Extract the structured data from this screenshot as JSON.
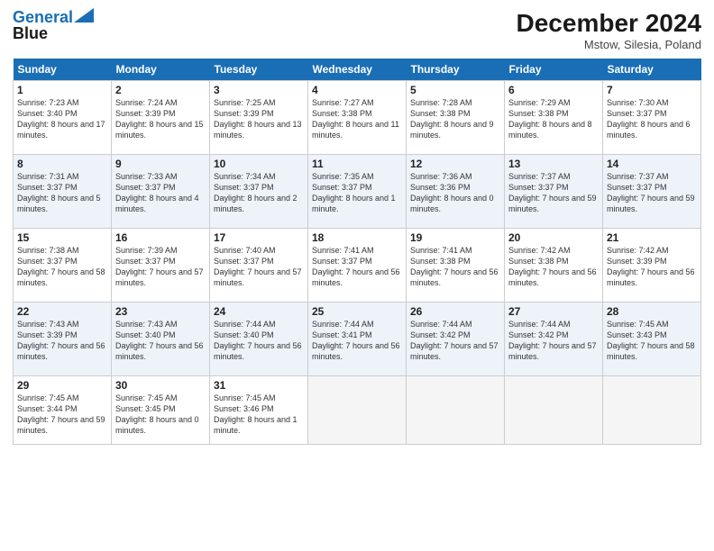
{
  "header": {
    "logo_line1": "General",
    "logo_line2": "Blue",
    "month_title": "December 2024",
    "location": "Mstow, Silesia, Poland"
  },
  "days_of_week": [
    "Sunday",
    "Monday",
    "Tuesday",
    "Wednesday",
    "Thursday",
    "Friday",
    "Saturday"
  ],
  "weeks": [
    [
      {
        "day": "1",
        "sunrise": "7:23 AM",
        "sunset": "3:40 PM",
        "daylight": "8 hours and 17 minutes."
      },
      {
        "day": "2",
        "sunrise": "7:24 AM",
        "sunset": "3:39 PM",
        "daylight": "8 hours and 15 minutes."
      },
      {
        "day": "3",
        "sunrise": "7:25 AM",
        "sunset": "3:39 PM",
        "daylight": "8 hours and 13 minutes."
      },
      {
        "day": "4",
        "sunrise": "7:27 AM",
        "sunset": "3:38 PM",
        "daylight": "8 hours and 11 minutes."
      },
      {
        "day": "5",
        "sunrise": "7:28 AM",
        "sunset": "3:38 PM",
        "daylight": "8 hours and 9 minutes."
      },
      {
        "day": "6",
        "sunrise": "7:29 AM",
        "sunset": "3:38 PM",
        "daylight": "8 hours and 8 minutes."
      },
      {
        "day": "7",
        "sunrise": "7:30 AM",
        "sunset": "3:37 PM",
        "daylight": "8 hours and 6 minutes."
      }
    ],
    [
      {
        "day": "8",
        "sunrise": "7:31 AM",
        "sunset": "3:37 PM",
        "daylight": "8 hours and 5 minutes."
      },
      {
        "day": "9",
        "sunrise": "7:33 AM",
        "sunset": "3:37 PM",
        "daylight": "8 hours and 4 minutes."
      },
      {
        "day": "10",
        "sunrise": "7:34 AM",
        "sunset": "3:37 PM",
        "daylight": "8 hours and 2 minutes."
      },
      {
        "day": "11",
        "sunrise": "7:35 AM",
        "sunset": "3:37 PM",
        "daylight": "8 hours and 1 minute."
      },
      {
        "day": "12",
        "sunrise": "7:36 AM",
        "sunset": "3:36 PM",
        "daylight": "8 hours and 0 minutes."
      },
      {
        "day": "13",
        "sunrise": "7:37 AM",
        "sunset": "3:37 PM",
        "daylight": "7 hours and 59 minutes."
      },
      {
        "day": "14",
        "sunrise": "7:37 AM",
        "sunset": "3:37 PM",
        "daylight": "7 hours and 59 minutes."
      }
    ],
    [
      {
        "day": "15",
        "sunrise": "7:38 AM",
        "sunset": "3:37 PM",
        "daylight": "7 hours and 58 minutes."
      },
      {
        "day": "16",
        "sunrise": "7:39 AM",
        "sunset": "3:37 PM",
        "daylight": "7 hours and 57 minutes."
      },
      {
        "day": "17",
        "sunrise": "7:40 AM",
        "sunset": "3:37 PM",
        "daylight": "7 hours and 57 minutes."
      },
      {
        "day": "18",
        "sunrise": "7:41 AM",
        "sunset": "3:37 PM",
        "daylight": "7 hours and 56 minutes."
      },
      {
        "day": "19",
        "sunrise": "7:41 AM",
        "sunset": "3:38 PM",
        "daylight": "7 hours and 56 minutes."
      },
      {
        "day": "20",
        "sunrise": "7:42 AM",
        "sunset": "3:38 PM",
        "daylight": "7 hours and 56 minutes."
      },
      {
        "day": "21",
        "sunrise": "7:42 AM",
        "sunset": "3:39 PM",
        "daylight": "7 hours and 56 minutes."
      }
    ],
    [
      {
        "day": "22",
        "sunrise": "7:43 AM",
        "sunset": "3:39 PM",
        "daylight": "7 hours and 56 minutes."
      },
      {
        "day": "23",
        "sunrise": "7:43 AM",
        "sunset": "3:40 PM",
        "daylight": "7 hours and 56 minutes."
      },
      {
        "day": "24",
        "sunrise": "7:44 AM",
        "sunset": "3:40 PM",
        "daylight": "7 hours and 56 minutes."
      },
      {
        "day": "25",
        "sunrise": "7:44 AM",
        "sunset": "3:41 PM",
        "daylight": "7 hours and 56 minutes."
      },
      {
        "day": "26",
        "sunrise": "7:44 AM",
        "sunset": "3:42 PM",
        "daylight": "7 hours and 57 minutes."
      },
      {
        "day": "27",
        "sunrise": "7:44 AM",
        "sunset": "3:42 PM",
        "daylight": "7 hours and 57 minutes."
      },
      {
        "day": "28",
        "sunrise": "7:45 AM",
        "sunset": "3:43 PM",
        "daylight": "7 hours and 58 minutes."
      }
    ],
    [
      {
        "day": "29",
        "sunrise": "7:45 AM",
        "sunset": "3:44 PM",
        "daylight": "7 hours and 59 minutes."
      },
      {
        "day": "30",
        "sunrise": "7:45 AM",
        "sunset": "3:45 PM",
        "daylight": "8 hours and 0 minutes."
      },
      {
        "day": "31",
        "sunrise": "7:45 AM",
        "sunset": "3:46 PM",
        "daylight": "8 hours and 1 minute."
      },
      null,
      null,
      null,
      null
    ]
  ]
}
